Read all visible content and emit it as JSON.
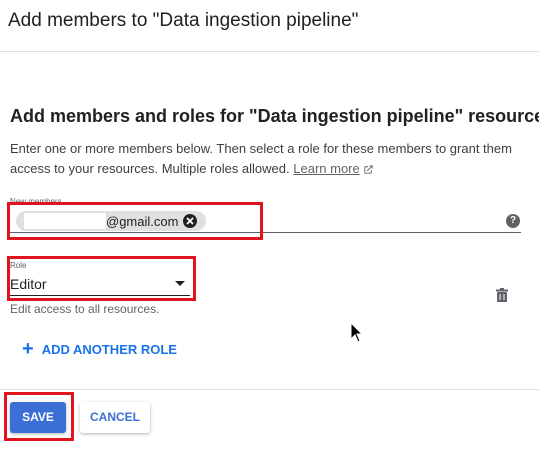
{
  "dialog": {
    "title": "Add members to \"Data ingestion pipeline\""
  },
  "section": {
    "heading": "Add members and roles for \"Data ingestion pipeline\" resource",
    "description": "Enter one or more members below. Then select a role for these members to grant them access to your resources. Multiple roles allowed.",
    "learn_more": "Learn more"
  },
  "members": {
    "label": "New members",
    "chip_text": "@gmail.com"
  },
  "role": {
    "label": "Role",
    "value": "Editor",
    "helper": "Edit access to all resources."
  },
  "actions": {
    "add_role": "ADD ANOTHER ROLE",
    "save": "SAVE",
    "cancel": "CANCEL"
  },
  "icons": {
    "external_link": "external-link-icon",
    "chip_remove": "close-circle-icon",
    "help": "help-icon",
    "delete": "trash-icon",
    "add": "plus-icon",
    "dropdown": "caret-down-icon",
    "cursor": "mouse-pointer-icon"
  },
  "colors": {
    "primary": "#3b6fd6",
    "highlight": "#e0141e",
    "link": "#5f6368"
  }
}
